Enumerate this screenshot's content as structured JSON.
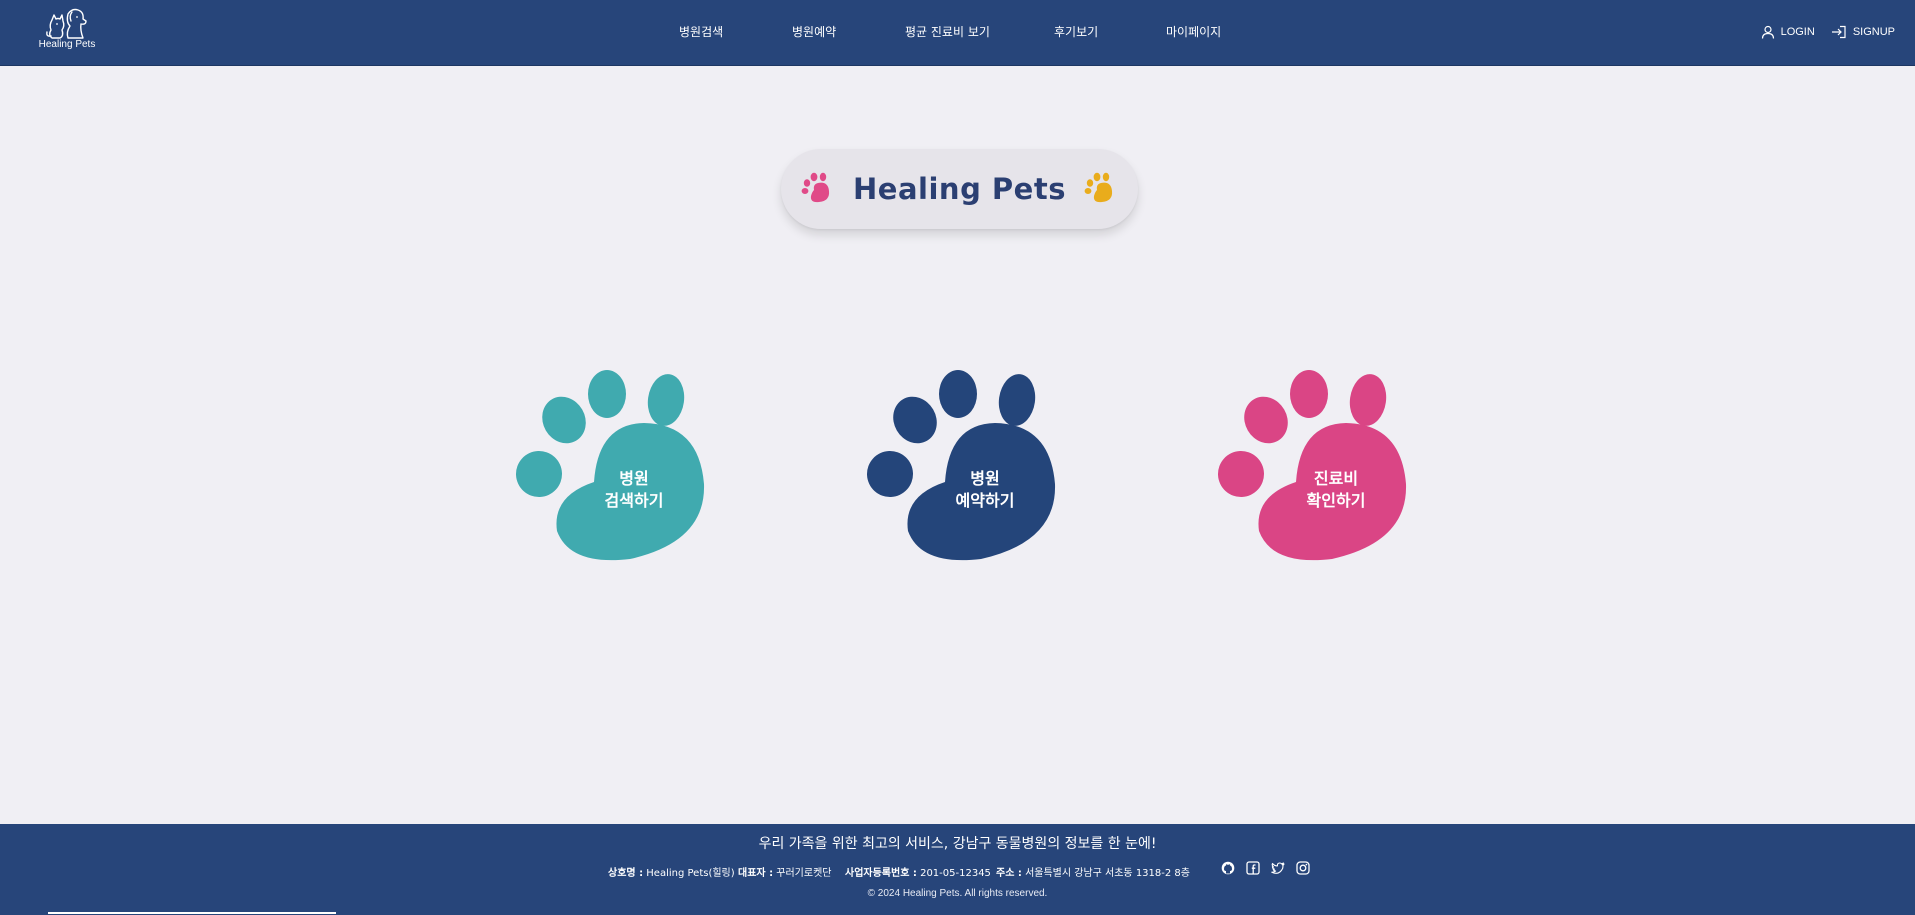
{
  "header": {
    "logo_text": "Healing Pets",
    "nav": [
      "병원검색",
      "병원예약",
      "평균 진료비 보기",
      "후기보기",
      "마이페이지"
    ],
    "login": "LOGIN",
    "signup": "SIGNUP"
  },
  "hero": {
    "title": "Healing Pets"
  },
  "paws": [
    {
      "label": "병원\n검색하기",
      "color": "#40aaaf"
    },
    {
      "label": "병원\n예약하기",
      "color": "#24457a"
    },
    {
      "label": "진료비\n확인하기",
      "color": "#da4585"
    }
  ],
  "colors": {
    "navy": "#27457a",
    "background": "#f0eff4",
    "title_pink_paw": "#e04a88",
    "title_yellow_paw": "#e9ac1c"
  },
  "footer": {
    "tagline": "우리 가족을 위한 최고의 서비스, 강남구 동물병원의 정보를 한 눈에!",
    "company_label": "상호명 :",
    "company_value": "Healing Pets(힐링)",
    "ceo_label": "대표자 :",
    "ceo_value": "꾸러기로켓단",
    "bizno_label": "사업자등록번호 :",
    "bizno_value": "201-05-12345",
    "address_label": "주소 :",
    "address_value": "서울특별시 강남구 서초동 1318-2 8층",
    "socials": [
      "github-icon",
      "facebook-icon",
      "twitter-icon",
      "instagram-icon"
    ],
    "copyright": "© 2024 Healing Pets. All rights reserved."
  }
}
